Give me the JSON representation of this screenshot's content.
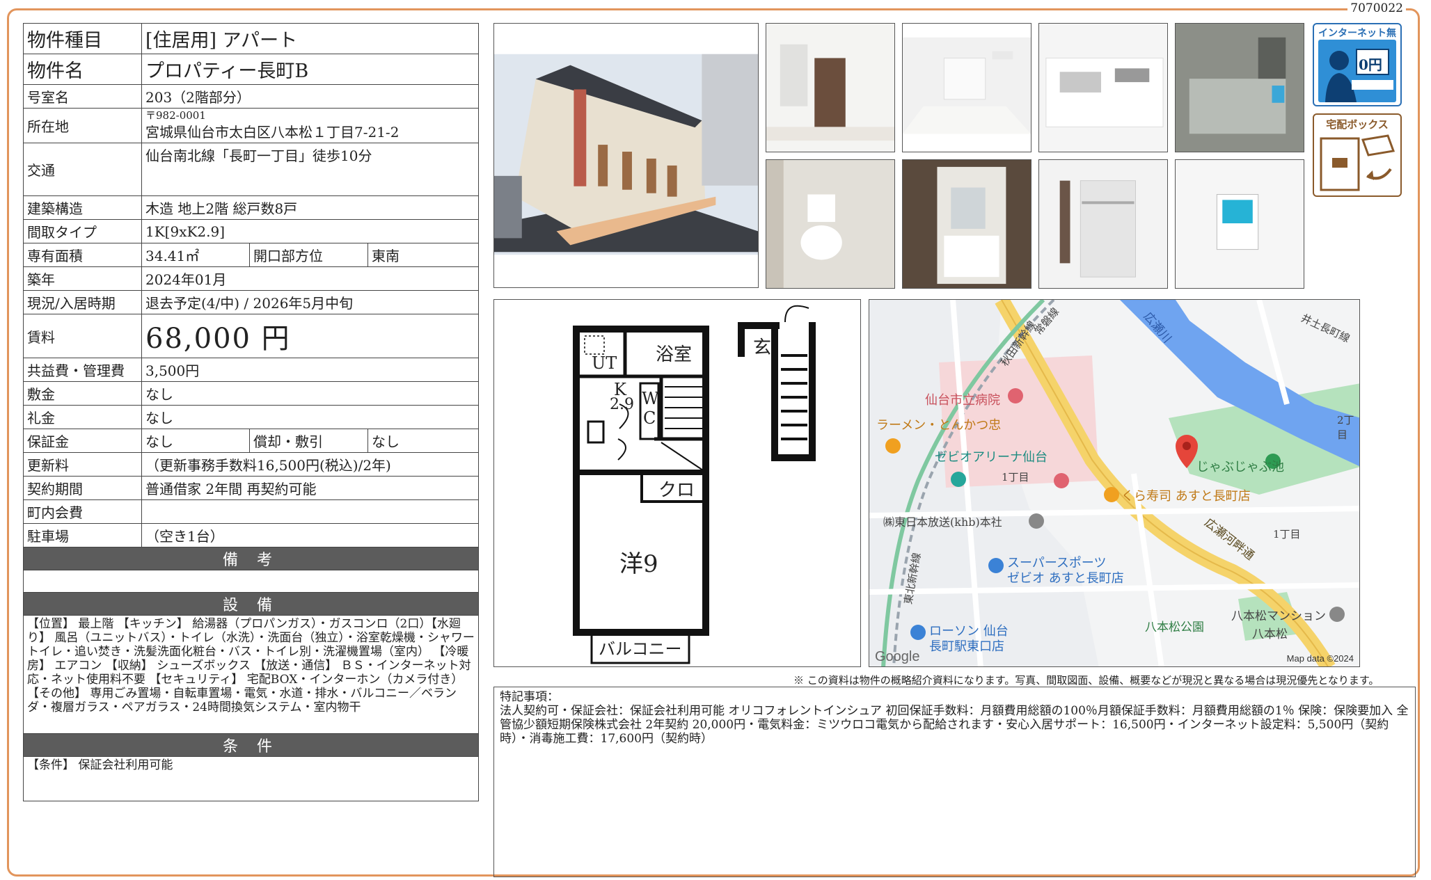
{
  "doc_number": "7070022",
  "property": {
    "type_label": "物件種目",
    "type_value": "[住居用] アパート",
    "name_label": "物件名",
    "name_value": "プロパティー長町B",
    "room_label": "号室名",
    "room_value": "203（2階部分）",
    "address_label": "所在地",
    "postal": "〒982-0001",
    "address_value": "宮城県仙台市太白区八本松１丁目7-21-2",
    "access_label": "交通",
    "access_value": "仙台南北線「長町一丁目」徒歩10分",
    "structure_label": "建築構造",
    "structure_value": "木造 地上2階 総戸数8戸",
    "layout_label": "間取タイプ",
    "layout_value": "1K[9xK2.9]",
    "area_label": "専有面積",
    "area_value": "34.41㎡",
    "direction_label": "開口部方位",
    "direction_value": "東南",
    "built_label": "築年",
    "built_value": "2024年01月",
    "status_label": "現況/入居時期",
    "status_value": "退去予定(4/中) / 2026年5月中旬",
    "rent_label": "賃料",
    "rent_value": "68,000 円",
    "fee_label": "共益費・管理費",
    "fee_value": "3,500円",
    "deposit_label": "敷金",
    "deposit_value": "なし",
    "keymoney_label": "礼金",
    "keymoney_value": "なし",
    "guarantee_label": "保証金",
    "guarantee_value": "なし",
    "amort_label": "償却・敷引",
    "amort_value": "なし",
    "renewal_label": "更新料",
    "renewal_value": "（更新事務手数料16,500円(税込)/2年)",
    "contract_label": "契約期間",
    "contract_value": "普通借家 2年間 再契約可能",
    "town_label": "町内会費",
    "town_value": "",
    "parking_label": "駐車場",
    "parking_value": "（空き1台）"
  },
  "sections": {
    "remarks": "備 考",
    "equipment": "設 備",
    "conditions": "条 件"
  },
  "equipment_text": "【位置】 最上階 【キッチン】 給湯器（プロパンガス）・ガスコンロ（2口）【水廻り】 風呂（ユニットバス）・トイレ（水洗）・洗面台（独立）・浴室乾燥機・シャワートイレ・追い焚き・洗髪洗面化粧台・バス・トイレ別・洗濯機置場（室内） 【冷暖房】 エアコン 【収納】 シューズボックス 【放送・通信】 ＢＳ・インターネット対応・ネット使用料不要 【セキュリティ】 宅配BOX・インターホン（カメラ付き） 【その他】 専用ごみ置場・自転車置場・電気・水道・排水・バルコニー／ベランダ・複層ガラス・ペアガラス・24時間換気システム・室内物干",
  "conditions_text": "【条件】 保証会社利用可能",
  "badges": {
    "internet_free": "インターネット無料",
    "internet_zero": "0円",
    "delivery_box": "宅配ボックス"
  },
  "floorplan": {
    "ut": "UT",
    "bath": "浴室",
    "entrance": "玄",
    "kitchen": "K",
    "kitchen_size": "2.9",
    "wc_w": "W",
    "wc_c": "C",
    "closet": "クロ",
    "room": "洋9",
    "balcony": "バルコニー"
  },
  "map": {
    "labels": [
      "仙台市立病院",
      "ラーメン・とんかつ忠",
      "ゼビオアリーナ仙台",
      "1丁目",
      "じゃぶじゃぶ池",
      "くら寿司 あすと長町店",
      "㈱東日本放送(khb)本社",
      "スーパースポーツ",
      "ゼビオ あすと長町店",
      "広瀬河畔通",
      "八本松公園",
      "八本松マンション",
      "八本松",
      "ローソン 仙台",
      "長町駅東口店",
      "1丁目",
      "2丁目",
      "広瀬川",
      "井土長町線",
      "常磐線",
      "秋田新幹線",
      "東北新幹線"
    ],
    "google": "Google",
    "mapdata": "Map data ©2024"
  },
  "disclaimer": "※ この資料は物件の概略紹介資料になります。写真、間取図面、設備、概要などが現況と異なる場合は現況優先となります。",
  "special_title": "特記事項：",
  "special_text": "法人契約可・保証会社：保証会社利用可能 オリコフォレントインシュア 初回保証手数料：月額費用総額の100％月額保証手数料：月額費用総額の1％ 保険：保険要加入 全管協少額短期保険株式会社 2年契約 20,000円・電気料金：ミツウロコ電気から配給されます・安心入居サポート：16,500円・インターネット設定料：5,500円（契約時）・消毒施工費：17,600円（契約時）",
  "colors": {
    "frame": "#e2955c",
    "section_bg": "#5c5c5c",
    "badge_blue": "#2a6fb5",
    "badge_brown": "#8a5a2b",
    "map_bg": "#e9ecef",
    "river": "#6fa4f0",
    "road_yellow": "#f5d36a",
    "park_green": "#b5e2bd",
    "pin_red": "#e5453a"
  }
}
